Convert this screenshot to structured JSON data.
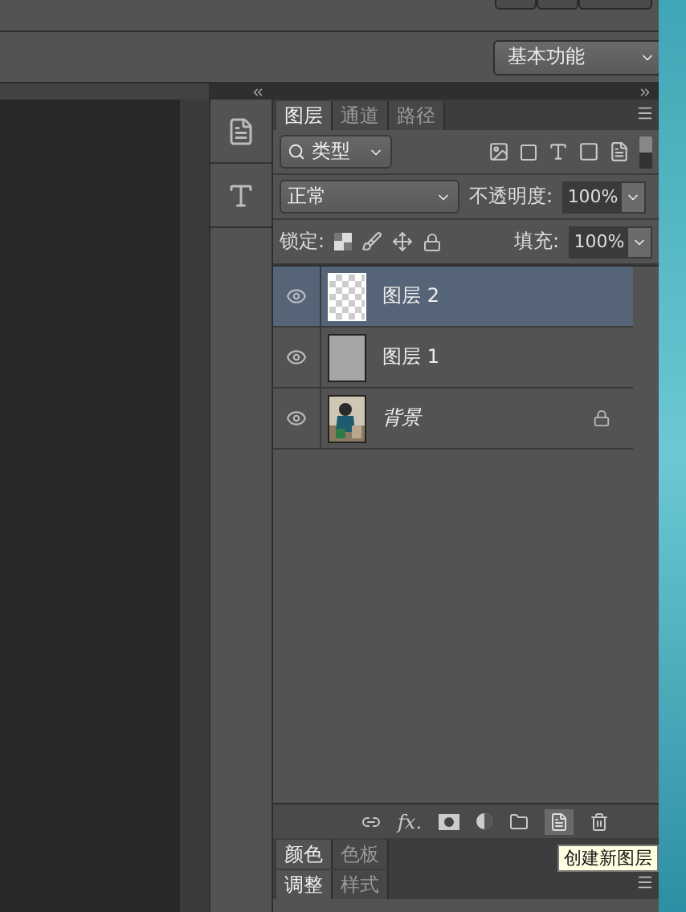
{
  "workspace_dropdown": {
    "value": "基本功能"
  },
  "layers_panel": {
    "tabs": [
      {
        "label": "图层",
        "selected": true
      },
      {
        "label": "通道",
        "selected": false
      },
      {
        "label": "路径",
        "selected": false
      }
    ],
    "filter": {
      "value": "类型"
    },
    "blend_mode": {
      "value": "正常"
    },
    "opacity": {
      "label": "不透明度:",
      "value": "100%"
    },
    "lock": {
      "label": "锁定:"
    },
    "fill": {
      "label": "填充:",
      "value": "100%"
    },
    "layers": [
      {
        "name": "图层 2",
        "kind": "transparent",
        "visible": true,
        "selected": true,
        "locked": false
      },
      {
        "name": "图层 1",
        "kind": "gray",
        "visible": true,
        "selected": false,
        "locked": false
      },
      {
        "name": "背景",
        "visible": true,
        "selected": false,
        "locked": true
      }
    ]
  },
  "footer": {
    "fx_label": "fx."
  },
  "tooltip": "创建新图层",
  "color_panel": {
    "tabs": [
      {
        "label": "颜色",
        "selected": true
      },
      {
        "label": "色板",
        "selected": false
      }
    ]
  },
  "adjust_panel": {
    "tabs": [
      {
        "label": "调整",
        "selected": true
      },
      {
        "label": "样式",
        "selected": false
      }
    ]
  }
}
